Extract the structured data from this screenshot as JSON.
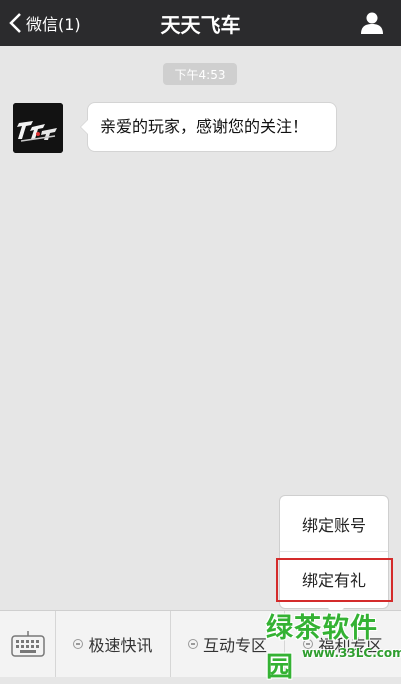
{
  "header": {
    "back_label": "微信(1)",
    "title": "天天飞车"
  },
  "chat": {
    "timestamp": "下午4:53",
    "message": {
      "text": "亲爱的玩家，感谢您的关注！",
      "sender_avatar": "tiantian-feiche-logo"
    }
  },
  "popup_menu": {
    "items": [
      "绑定账号",
      "绑定有礼"
    ],
    "highlighted_item": "绑定有礼"
  },
  "bottom_menu": {
    "tabs": [
      "极速快讯",
      "互动专区",
      "福利专区"
    ]
  },
  "watermark": {
    "title": "绿茶软件园",
    "url": "www.33LC.com"
  },
  "colors": {
    "topbar": "#2b2b2d",
    "chat_background": "#e6e6e6",
    "highlight": "#d42b2b",
    "watermark": "#34b233"
  }
}
